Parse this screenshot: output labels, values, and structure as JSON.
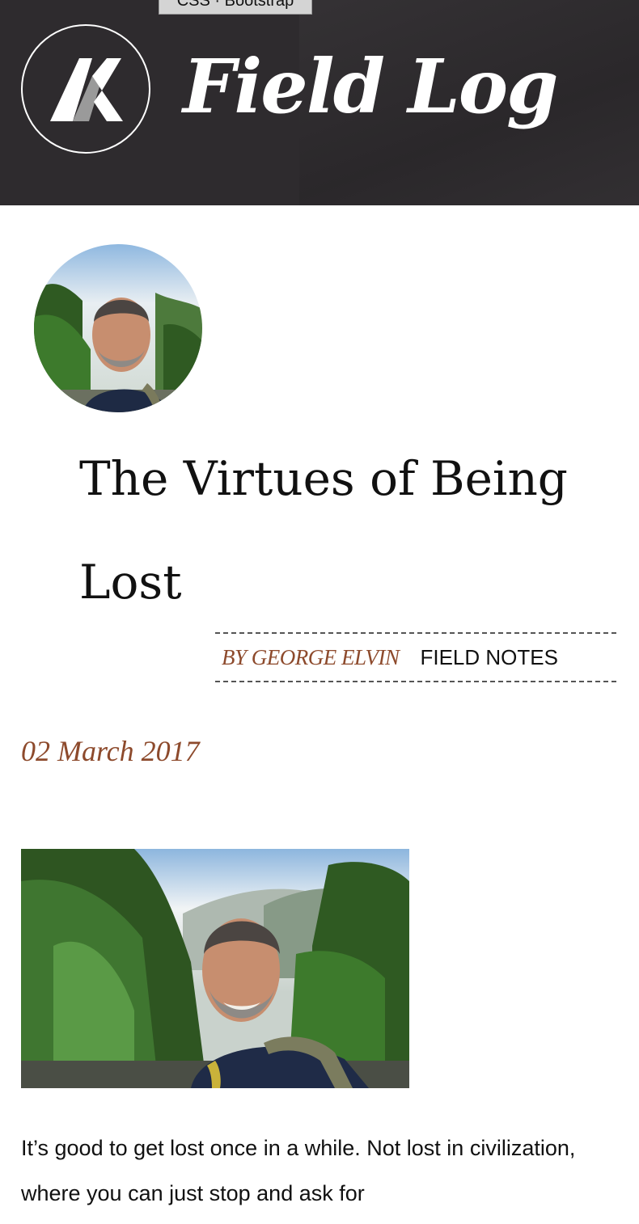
{
  "tooltip": {
    "text": "CSS · Bootstrap"
  },
  "header": {
    "logo_icon": "field-log-logo-icon",
    "site_title": "Field Log"
  },
  "post": {
    "avatar_icon": "author-avatar",
    "title": "The Virtues of Being Lost",
    "author": "BY GEORGE ELVIN",
    "category": "FIELD NOTES",
    "date": "02 March 2017",
    "photo_icon": "hiker-selfie-photo",
    "body": "It’s good to get lost once in a while. Not lost in civilization, where you can just stop and ask for"
  },
  "colors": {
    "header_bg": "#2e2b2e",
    "accent": "#8d4a2c",
    "text": "#111111"
  }
}
